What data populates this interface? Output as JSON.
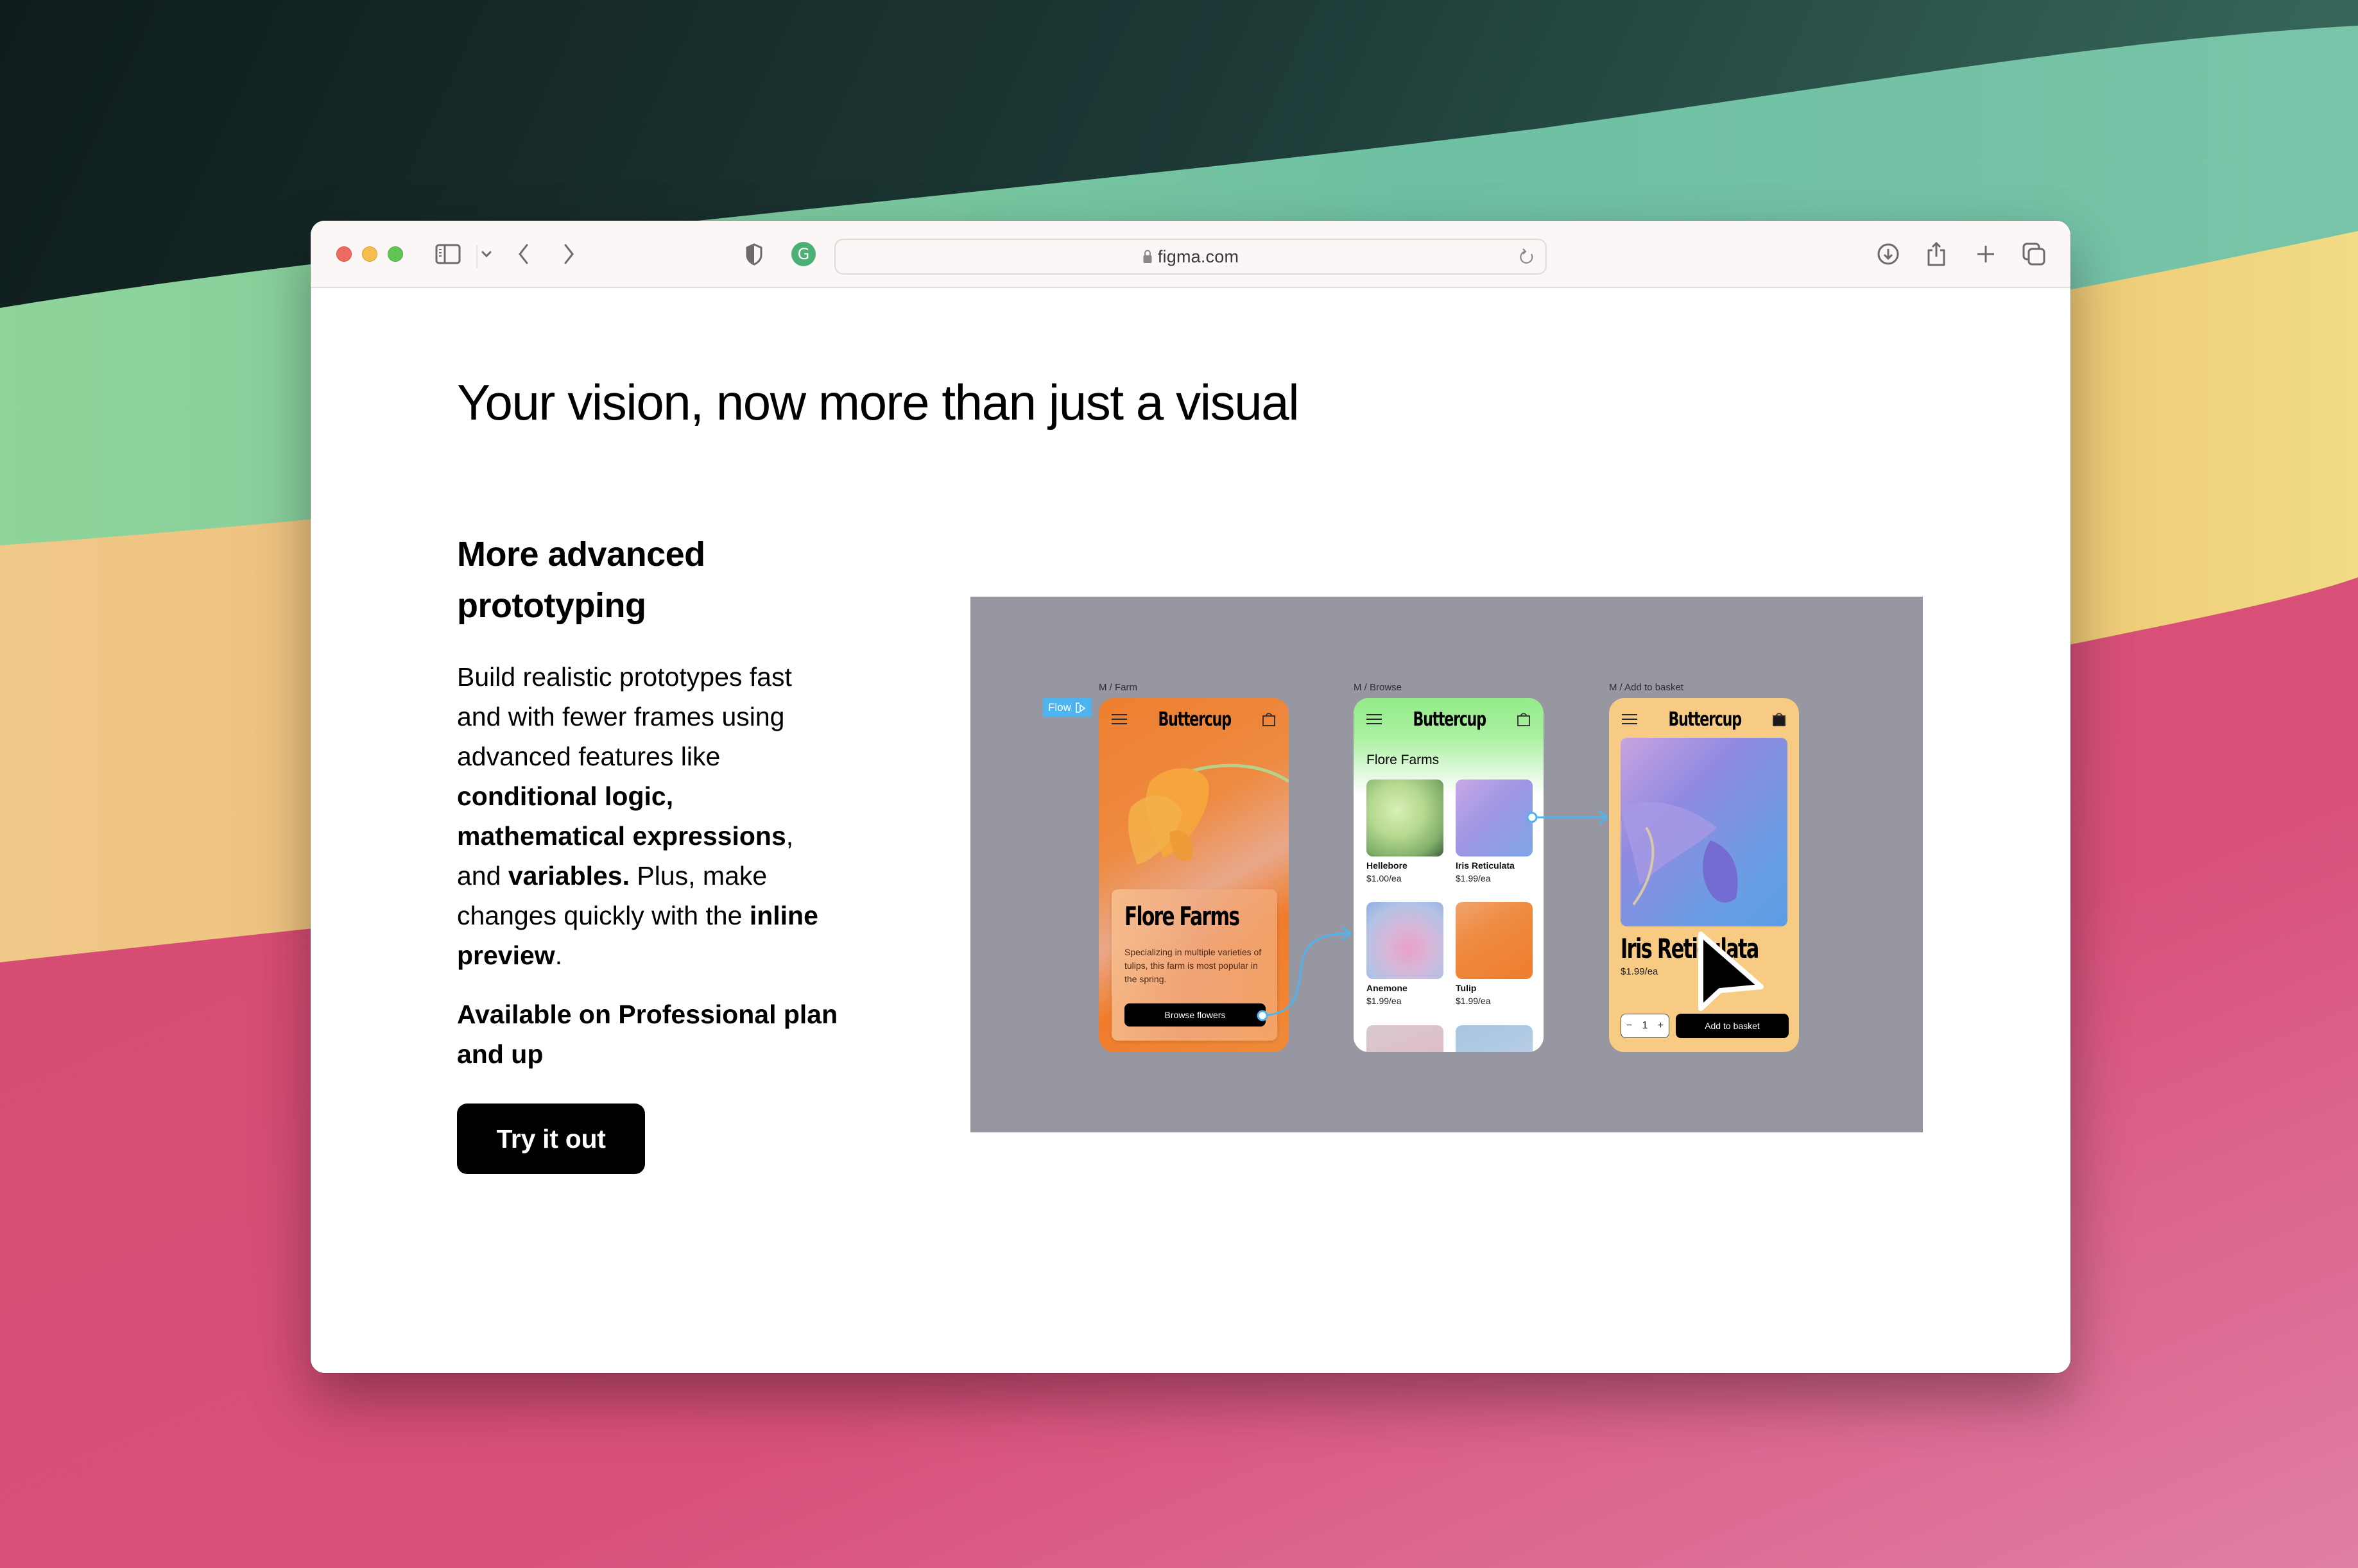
{
  "browser": {
    "url": "figma.com",
    "toolbar_icons": [
      "sidebar-icon",
      "chevron-down-icon",
      "back-icon",
      "forward-icon",
      "privacy-shield-icon",
      "grammarly-icon",
      "lock-icon",
      "reload-icon",
      "download-icon",
      "share-icon",
      "new-tab-icon",
      "tab-overview-icon"
    ],
    "traffic_lights": {
      "close": "#ec6a5e",
      "minimize": "#f4bf4f",
      "zoom": "#61c554"
    }
  },
  "page": {
    "hero_title": "Your vision, now more than just a visual",
    "feature": {
      "title_line1": "More advanced",
      "title_line2": "prototyping",
      "body": [
        {
          "text": "Build realistic prototypes fast and with fewer frames using advanced features like ",
          "bold": false
        },
        {
          "text": "conditional logic,",
          "bold": true
        },
        {
          "text": " ",
          "bold": false
        },
        {
          "text": "mathematical expressions",
          "bold": true
        },
        {
          "text": ", and ",
          "bold": false
        },
        {
          "text": "variables.",
          "bold": true
        },
        {
          "text": " Plus, make changes quickly with the ",
          "bold": false
        },
        {
          "text": "inline preview",
          "bold": true
        },
        {
          "text": ".",
          "bold": false
        }
      ],
      "plan_note": "Available on Professional plan and up",
      "cta_label": "Try it out"
    }
  },
  "prototype_preview": {
    "flow_tag": "Flow",
    "frames": [
      {
        "label": "M / Farm",
        "brand": "Buttercup",
        "card_title": "Flore Farms",
        "card_text": "Specializing in multiple varieties of tulips, this farm is most popular in the spring.",
        "button": "Browse flowers",
        "accent": "#ee7f2f"
      },
      {
        "label": "M / Browse",
        "brand": "Buttercup",
        "subtitle": "Flore Farms",
        "products": [
          {
            "name": "Hellebore",
            "price": "$1.00/ea"
          },
          {
            "name": "Iris Reticulata",
            "price": "$1.99/ea"
          },
          {
            "name": "Anemone",
            "price": "$1.99/ea"
          },
          {
            "name": "Tulip",
            "price": "$1.99/ea"
          }
        ],
        "accent": "#94ec8a"
      },
      {
        "label": "M / Add to basket",
        "brand": "Buttercup",
        "product_title": "Iris Reticulata",
        "price": "$1.99/ea",
        "quantity": "1",
        "qty_minus": "−",
        "qty_plus": "+",
        "button": "Add to basket",
        "accent": "#f7cb84"
      }
    ],
    "connector_color": "#4db4f0",
    "canvas_color": "#9797a2"
  }
}
